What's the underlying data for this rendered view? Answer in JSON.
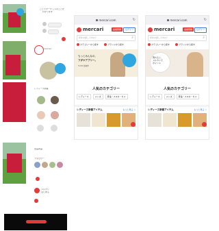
{
  "storyboard": {
    "chat_line_1": "ここでマーケットのことが",
    "chat_line_2": "わかります",
    "profile_badge": "mercari",
    "section_label": "レディース新着",
    "feed_label": "出品商品",
    "feed_label_2": "フォロワー",
    "footer_label": "メルカリ",
    "footer_label_2": "はじめる"
  },
  "phones": [
    {
      "url": "mercari.com",
      "logo": "mercari",
      "signup_label": "会員登録",
      "login_label": "ログイン",
      "search_placeholder": "何をお探しですか？",
      "category_link": "カテゴリーから探す",
      "brand_link": "ブランドから探す",
      "banner_line_1": "もっとみんなの、",
      "banner_line_2": "フダヤアプリー。",
      "banner_sub": "TVCM 放映中",
      "popular_title": "人気のカテゴリー",
      "tabs": [
        "レディース",
        "メンズ",
        "家電・スマホ・カメ"
      ],
      "new_items_title": "レディース新着アイテム",
      "more_link": "もっと見る >"
    },
    {
      "url": "mercari.com",
      "logo": "mercari",
      "signup_label": "会員登録",
      "login_label": "ログイン",
      "search_placeholder": "何をお探しですか？",
      "category_link": "カテゴリーから探す",
      "brand_link": "ブランドから探す",
      "banner_line_1": "売れると、",
      "banner_line_2": "メルカリで",
      "banner_line_3": "ポイント",
      "banner_sub": "",
      "popular_title": "人気のカテゴリー",
      "tabs": [
        "レディース",
        "メンズ",
        "家電・スマホ・カメ"
      ],
      "new_items_title": "レディース新着アイテム",
      "more_link": "もっと見る >"
    }
  ],
  "colors": {
    "brand_red": "#e33a3a",
    "link_blue": "#3a76e3",
    "box_red": "#c81e3c",
    "sphere_blue": "#2ea6e0"
  }
}
